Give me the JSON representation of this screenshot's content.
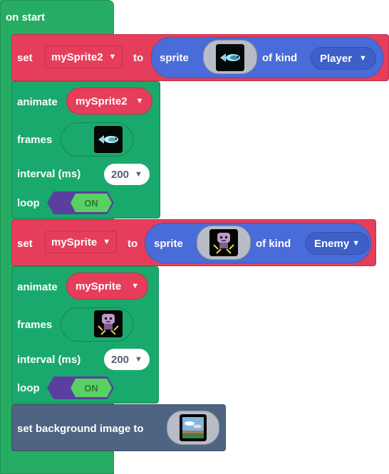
{
  "on_start": {
    "label": "on start"
  },
  "block1": {
    "set_label": "set",
    "variable": "mySprite2",
    "to_label": "to",
    "sprite_label": "sprite",
    "of_kind_label": "of kind",
    "kind": "Player"
  },
  "block2": {
    "animate_label": "animate",
    "variable": "mySprite2",
    "frames_label": "frames",
    "interval_label": "interval (ms)",
    "interval_value": "200",
    "loop_label": "loop",
    "loop_value": "ON"
  },
  "block3": {
    "set_label": "set",
    "variable": "mySprite",
    "to_label": "to",
    "sprite_label": "sprite",
    "of_kind_label": "of kind",
    "kind": "Enemy"
  },
  "block4": {
    "animate_label": "animate",
    "variable": "mySprite",
    "frames_label": "frames",
    "interval_label": "interval (ms)",
    "interval_value": "200",
    "loop_label": "loop",
    "loop_value": "ON"
  },
  "block5": {
    "label": "set background image to"
  },
  "icons": {
    "dropdown": "▼"
  }
}
